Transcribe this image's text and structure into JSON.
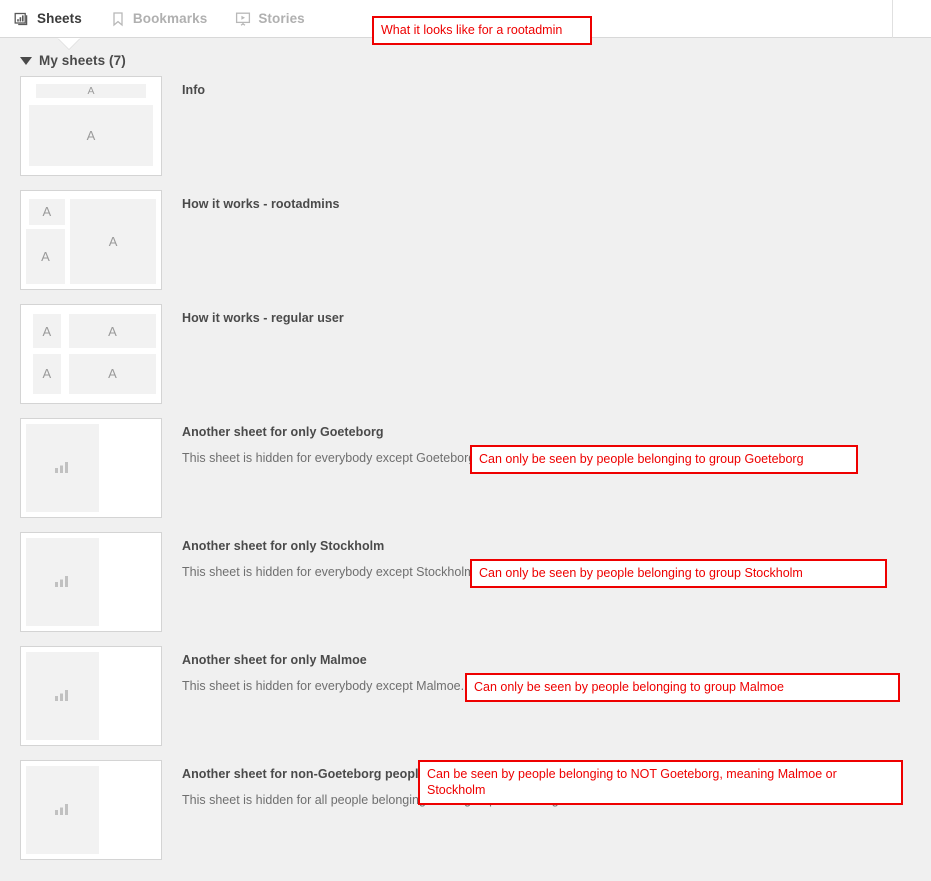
{
  "topbar": {
    "tabs": [
      {
        "label": "Sheets",
        "icon": "bar-chart-frame-icon",
        "active": true
      },
      {
        "label": "Bookmarks",
        "icon": "bookmark-icon",
        "active": false
      },
      {
        "label": "Stories",
        "icon": "story-play-icon",
        "active": false
      }
    ]
  },
  "section": {
    "title": "My sheets (7)",
    "caret": "caret-down-icon"
  },
  "annotations": {
    "top": "What it looks like for a rootadmin",
    "color": "#ee0000"
  },
  "sheets": [
    {
      "name": "Info",
      "desc": "",
      "layout": "lay-info",
      "blocks": [
        "A",
        "A"
      ],
      "annotation": null
    },
    {
      "name": "How it works - rootadmins",
      "desc": "",
      "layout": "lay-b",
      "blocks": [
        "A",
        "A",
        "A"
      ],
      "annotation": null
    },
    {
      "name": "How it works - regular user",
      "desc": "",
      "layout": "lay-c",
      "blocks": [
        "A",
        "A",
        "A",
        "A"
      ],
      "annotation": null
    },
    {
      "name": "Another sheet for only Goeteborg",
      "desc": "This sheet is hidden for everybody except Goeteborg.",
      "layout": "lay-chart",
      "blocks": [],
      "annotation": "Can only be seen by people belonging to group Goeteborg"
    },
    {
      "name": "Another sheet for only Stockholm",
      "desc": "This sheet is hidden for everybody except Stockholm.",
      "layout": "lay-chart",
      "blocks": [],
      "annotation": "Can only be seen by people belonging to group Stockholm"
    },
    {
      "name": "Another sheet for only Malmoe",
      "desc": "This sheet is hidden for everybody except Malmoe.",
      "layout": "lay-chart",
      "blocks": [],
      "annotation": "Can only be seen by people belonging to group Malmoe"
    },
    {
      "name": "Another sheet for non-Goeteborg people",
      "desc": "This sheet is hidden for all people belonging to the group Goeteborg.",
      "layout": "lay-chart",
      "blocks": [],
      "annotation": "Can be seen by people belonging to NOT Goeteborg, meaning Malmoe or Stockholm"
    }
  ]
}
